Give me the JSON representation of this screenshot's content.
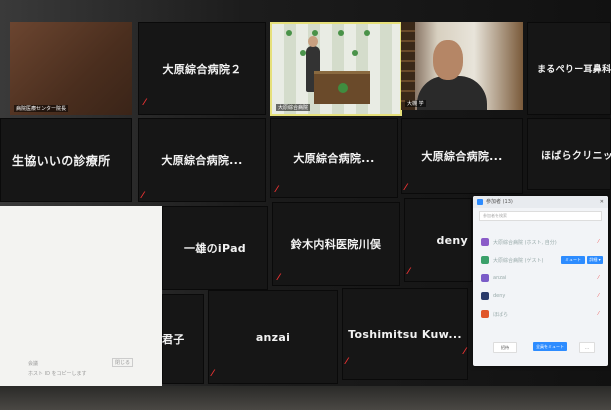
{
  "meeting": {
    "tiles": [
      {
        "id": "t-osaka2",
        "name": "大原綜合病院２",
        "muted": true
      },
      {
        "id": "t-marupeli",
        "name": "まるぺりー耳鼻科",
        "muted": false
      },
      {
        "id": "t-seikyo",
        "name": "生協いいの診療所",
        "muted": false
      },
      {
        "id": "t-osaka-a",
        "name": "大原綜合病院...",
        "muted": true
      },
      {
        "id": "t-osaka-b",
        "name": "大原綜合病院...",
        "muted": true
      },
      {
        "id": "t-osaka-c",
        "name": "大原綜合病院...",
        "muted": true
      },
      {
        "id": "t-hohara",
        "name": "ほばらクリニック",
        "muted": true
      },
      {
        "id": "t-ipad",
        "name": "一雄のiPad",
        "muted": true
      },
      {
        "id": "t-suzuki",
        "name": "鈴木内科医院川俣",
        "muted": true
      },
      {
        "id": "t-deny",
        "name": "deny",
        "muted": true
      },
      {
        "id": "t-kimiko",
        "name": "君子",
        "muted": true
      },
      {
        "id": "t-anzai",
        "name": "anzai",
        "muted": true
      },
      {
        "id": "t-toshimitsu",
        "name": "Toshimitsu Kuw...",
        "muted": true
      }
    ],
    "video_labels": {
      "brown": "病院医療センター院長",
      "podium": "大原綜合病院",
      "man": "大槻 学"
    }
  },
  "shared_window": {
    "line1": "会議",
    "line2": "ホスト ID をコピーします",
    "button": "閉じる"
  },
  "participants_popup": {
    "title": "参加者 (13)",
    "search_placeholder": "参加者を検索",
    "rows": [
      {
        "initial": "大",
        "name": "大原綜合病院 (ホスト, 自分)",
        "color": "#8a5cc8"
      },
      {
        "initial": "大",
        "name": "大原綜合病院 (ゲスト)",
        "color": "#3aa06a",
        "btn1": "ミュート",
        "btn2": "詳細 ▾"
      },
      {
        "initial": "a",
        "name": "anzai",
        "color": "#7a5cc8"
      },
      {
        "initial": "D",
        "name": "deny",
        "color": "#2a3a6a"
      },
      {
        "initial": "B",
        "name": "ほばら",
        "color": "#e0562a"
      }
    ],
    "invite_label": "招待",
    "mute_all_label": "全員をミュート",
    "more_label": "..."
  },
  "colors": {
    "muted_icon": "#e33333",
    "active_speaker_border": "#e6e07a",
    "zoom_blue": "#2d8cff"
  }
}
